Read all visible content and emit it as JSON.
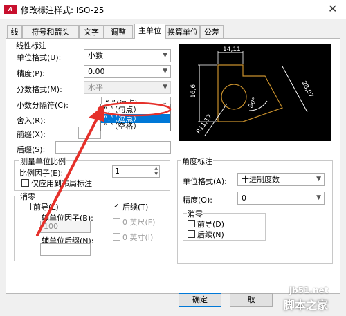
{
  "window": {
    "title": "修改标注样式: ISO-25",
    "app_icon": "A",
    "close_glyph": "✕"
  },
  "tabs": [
    {
      "label": "线"
    },
    {
      "label": "符号和箭头"
    },
    {
      "label": "文字"
    },
    {
      "label": "调整"
    },
    {
      "label": "主单位",
      "active": true
    },
    {
      "label": "换算单位"
    },
    {
      "label": "公差"
    }
  ],
  "linear": {
    "group_title": "线性标注",
    "unit_format_label": "单位格式(U):",
    "unit_format_value": "小数",
    "precision_label": "精度(P):",
    "precision_value": "0.00",
    "fraction_format_label": "分数格式(M):",
    "fraction_format_value": "水平",
    "decimal_sep_label": "小数分隔符(C):",
    "decimal_sep_value": "“,”（逗点）",
    "decimal_sep_options": [
      {
        "label": "“,”（句点）",
        "selected": false
      },
      {
        "label": "“.”（逗点）",
        "selected": true
      },
      {
        "label": "“ ”（空格）",
        "selected": false
      }
    ],
    "round_off_label": "舍入(R):",
    "prefix_label": "前缀(X):",
    "suffix_label": "后缀(S):"
  },
  "scale": {
    "group_title": "测量单位比例",
    "factor_label": "比例因子(E):",
    "factor_value": "1",
    "layout_only_label": "仅应用到布局标注"
  },
  "zero_suppress": {
    "group_title": "消零",
    "leading_label": "前导(L)",
    "trailing_label": "后续(T)",
    "trailing_checked": true,
    "sub_unit_factor_label": "辅单位因子(B):",
    "sub_unit_factor_value": "100",
    "zero_feet_label": "0 英尺(F)",
    "sub_unit_suffix_label": "辅单位后缀(N):",
    "zero_inches_label": "0 英寸(I)"
  },
  "angular": {
    "group_title": "角度标注",
    "unit_format_label": "单位格式(A):",
    "unit_format_value": "十进制度数",
    "precision_label": "精度(O):",
    "precision_value": "0",
    "zero_group_title": "消零",
    "leading_label": "前导(D)",
    "trailing_label": "后续(N)"
  },
  "preview": {
    "dim_top": "14,11",
    "dim_left": "16,6",
    "dim_right": "28,07",
    "dim_angle": "80°",
    "dim_radius": "R11,17",
    "line_color": "#ffffff",
    "shape_color": "#c8902c"
  },
  "buttons": {
    "ok": "确定",
    "cancel": "取"
  },
  "watermark": {
    "site": "jb51.net",
    "name": "脚本之家"
  },
  "annotation_color": "#e5302a"
}
